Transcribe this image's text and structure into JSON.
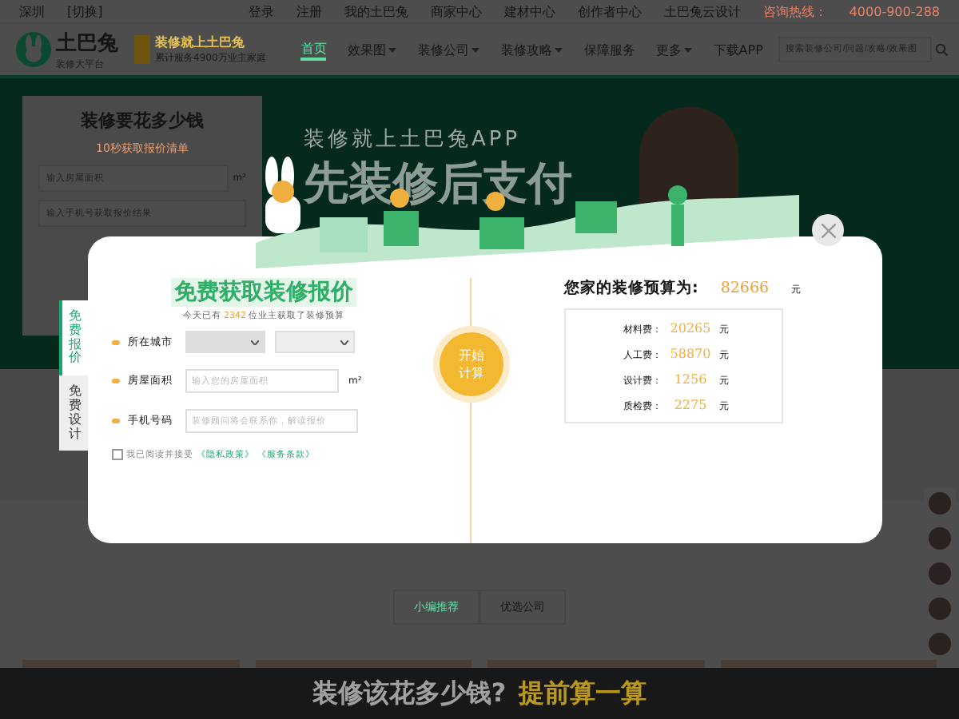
{
  "topbar": {
    "location": "深圳",
    "switch": "[切换]",
    "links": [
      "登录",
      "注册",
      "我的土巴兔",
      "商家中心",
      "建材中心",
      "创作者中心",
      "土巴兔云设计"
    ],
    "hotline_label": "咨询热线：",
    "hotline": "4000-900-288"
  },
  "header": {
    "logo": "土巴兔",
    "logo_sub": "装修大平台",
    "slogan": "装修就上土巴兔",
    "slogan_sub": "累计服务4900万业主家庭",
    "nav": [
      {
        "label": "首页",
        "selected": true,
        "dropdown": false
      },
      {
        "label": "效果图",
        "selected": false,
        "dropdown": true
      },
      {
        "label": "装修公司",
        "selected": false,
        "dropdown": true
      },
      {
        "label": "装修攻略",
        "selected": false,
        "dropdown": true
      },
      {
        "label": "保障服务",
        "selected": false,
        "dropdown": false
      },
      {
        "label": "更多",
        "selected": false,
        "dropdown": true
      },
      {
        "label": "下载APP",
        "selected": false,
        "dropdown": false
      }
    ],
    "search": {
      "placeholder": "搜索装修公司/问题/攻略/效果图"
    }
  },
  "banner": {
    "form_title": "装修要花多少钱",
    "form_subtitle": "10秒获取报价清单",
    "area_placeholder": "输入房屋面积",
    "area_unit": "m²",
    "phone_placeholder": "输入手机号获取报价结果",
    "headline": "装修就上土巴兔APP",
    "slogan": "先装修后支付"
  },
  "section_tabs": [
    {
      "label": "小编推荐",
      "selected": true
    },
    {
      "label": "优选公司",
      "selected": false
    }
  ],
  "bottom_banner": {
    "question": "装修该花多少钱?",
    "cta": "提前算一算"
  },
  "modal": {
    "tabs": [
      {
        "label": "免费报价",
        "selected": true
      },
      {
        "label": "免费设计",
        "selected": false
      }
    ],
    "title": "免费获取装修报价",
    "count_prefix": "今天已有",
    "count": "2342",
    "count_suffix": "位业主获取了装修预算",
    "fields": [
      {
        "kind": "select",
        "label": "所在城市"
      },
      {
        "kind": "input",
        "label": "房屋面积",
        "placeholder": "输入您的房屋面积",
        "unit": "m²"
      },
      {
        "kind": "input",
        "label": "手机号码",
        "placeholder": "装修顾问将会联系你，解读报价"
      }
    ],
    "agree": {
      "checked": false,
      "text": "我已阅读并接受",
      "links": [
        "《隐私政策》",
        "《服务条款》"
      ]
    },
    "calc_button": "开始计算",
    "result_title": "您家的装修预算为:",
    "total": "82666",
    "total_unit": "元",
    "items": [
      {
        "label": "材料费：",
        "value": "20265",
        "unit": "元"
      },
      {
        "label": "人工费：",
        "value": "58870",
        "unit": "元"
      },
      {
        "label": "设计费：",
        "value": "1256",
        "unit": "元"
      },
      {
        "label": "质检费：",
        "value": "2275",
        "unit": "元"
      }
    ]
  }
}
